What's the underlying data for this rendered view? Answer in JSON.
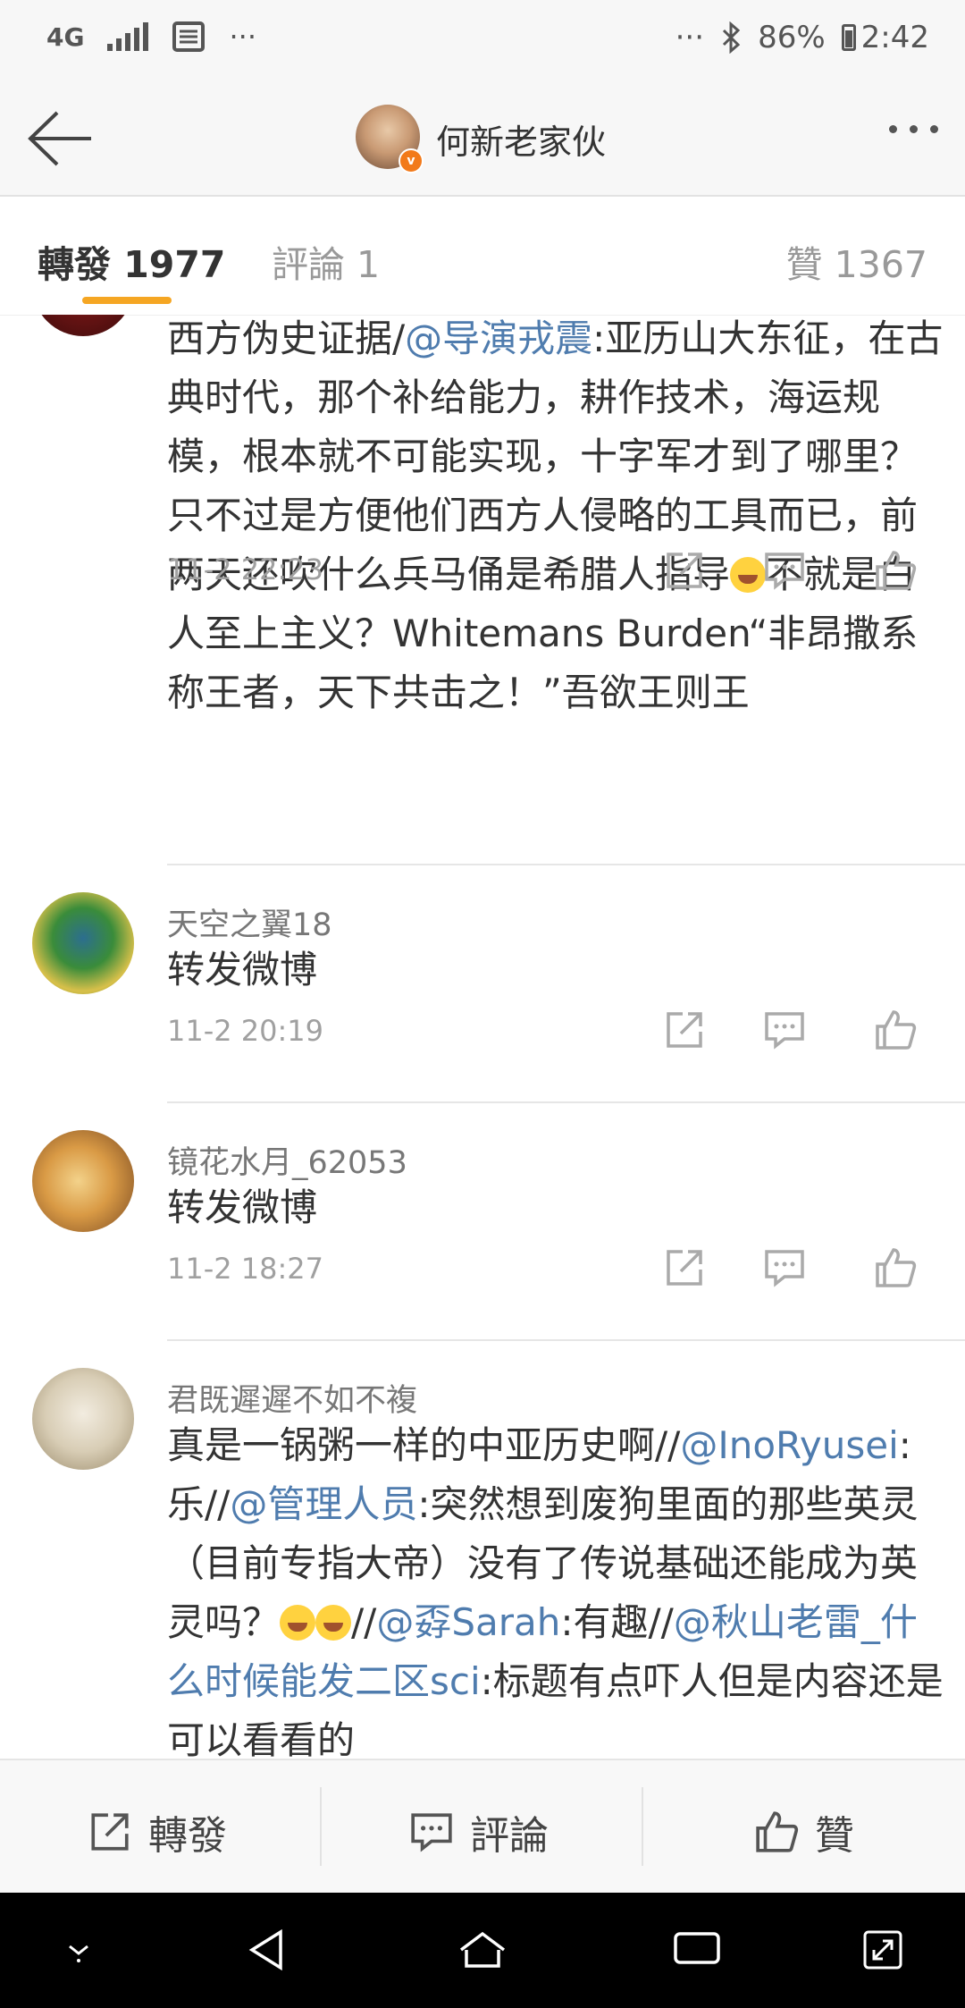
{
  "status_bar": {
    "network": "4G",
    "left_dots": "···",
    "right_dots": "···",
    "battery": "86%",
    "time": "2:42"
  },
  "header": {
    "title": "何新老家伙",
    "verified_badge": "v"
  },
  "tabs": {
    "repost": "轉發 1977",
    "comment": "評論 1",
    "like": "贊 1367"
  },
  "comments": [
    {
      "text_parts": [
        "西方伪史证据/",
        "@导演戎震",
        ":亚历山大东征，在古典时代，那个补给能力，耕作技术，海运规模，根本就不可能实现，十字军才到了哪里？只不过是方便他们西方人侵略的工具而已，前两天还吹什么兵马俑是希腊人指导",
        "不就是白人至上主义？Whitemans Burden“非昂撒系称王者，天下共击之！”吾欲王则王"
      ],
      "time": "11-2 22:23"
    },
    {
      "name": "天空之翼18",
      "text": "转发微博",
      "time": "11-2 20:19"
    },
    {
      "name": "镜花水月_62053",
      "text": "转发微博",
      "time": "11-2 18:27"
    },
    {
      "name": "君既遲遲不如不複",
      "text_parts": [
        "真是一锅粥一样的中亚历史啊//",
        "@InoRyusei",
        ":乐//",
        "@管理人员",
        ":突然想到废狗里面的那些英灵（目前专指大帝）没有了传说基础还能成为英灵吗？",
        "//",
        "@孬Sarah",
        ":有趣//",
        "@秋山老雷_什么时候能发二区sci",
        ":标题有点吓人但是内容还是可以看看的"
      ]
    }
  ],
  "bottom_bar": {
    "repost": "轉發",
    "comment": "評論",
    "like": "贊"
  },
  "colors": {
    "link": "#4f7cae",
    "tab_indicator": "#f5a623",
    "verified": "#f27a1a"
  }
}
